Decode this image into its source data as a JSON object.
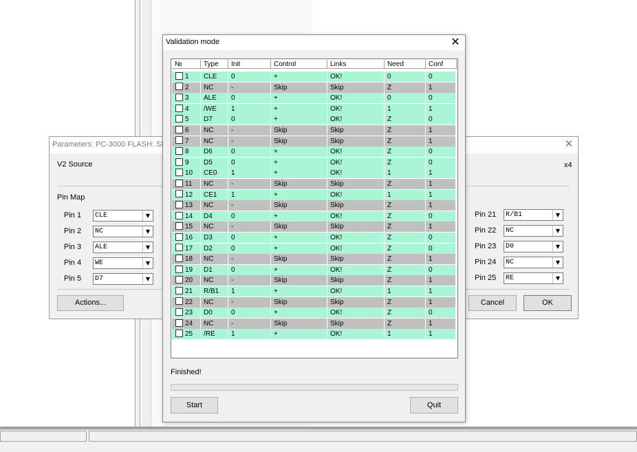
{
  "params_dialog": {
    "title": "Parameters: PC-3000 FLASH: SPID",
    "v2_source_label": "V2 Source",
    "x4_label": "x4",
    "pin_map_label": "Pin Map",
    "left_pins": [
      {
        "label": "Pin 1",
        "value": "CLE"
      },
      {
        "label": "Pin 2",
        "value": "NC"
      },
      {
        "label": "Pin 3",
        "value": "ALE"
      },
      {
        "label": "Pin 4",
        "value": "WE"
      },
      {
        "label": "Pin 5",
        "value": "D7"
      }
    ],
    "right_pins": [
      {
        "label": "Pin 21",
        "value": "R/B1"
      },
      {
        "label": "Pin 22",
        "value": "NC"
      },
      {
        "label": "Pin 23",
        "value": "D0"
      },
      {
        "label": "Pin 24",
        "value": "NC"
      },
      {
        "label": "Pin 25",
        "value": "RE"
      }
    ],
    "actions_label": "Actions...",
    "cancel_label": "Cancel",
    "ok_label": "OK"
  },
  "validation_dialog": {
    "title": "Validation mode",
    "close_glyph": "✕",
    "columns": [
      "№",
      "Type",
      "Init",
      "Control",
      "Links",
      "Need",
      "Conf"
    ],
    "rows": [
      {
        "n": "1",
        "type": "CLE",
        "init": "0",
        "control": "+",
        "links": "OK!",
        "need": "0",
        "conf": "0",
        "status": "ok"
      },
      {
        "n": "2",
        "type": "NC",
        "init": "-",
        "control": "Skip",
        "links": "Skip",
        "need": "Z",
        "conf": "1",
        "status": "skip"
      },
      {
        "n": "3",
        "type": "ALE",
        "init": "0",
        "control": "+",
        "links": "OK!",
        "need": "0",
        "conf": "0",
        "status": "ok"
      },
      {
        "n": "4",
        "type": "/WE",
        "init": "1",
        "control": "+",
        "links": "OK!",
        "need": "1",
        "conf": "1",
        "status": "ok"
      },
      {
        "n": "5",
        "type": "D7",
        "init": "0",
        "control": "+",
        "links": "OK!",
        "need": "Z",
        "conf": "0",
        "status": "ok"
      },
      {
        "n": "6",
        "type": "NC",
        "init": "-",
        "control": "Skip",
        "links": "Skip",
        "need": "Z",
        "conf": "1",
        "status": "skip"
      },
      {
        "n": "7",
        "type": "NC",
        "init": "-",
        "control": "Skip",
        "links": "Skip",
        "need": "Z",
        "conf": "1",
        "status": "skip"
      },
      {
        "n": "8",
        "type": "D6",
        "init": "0",
        "control": "+",
        "links": "OK!",
        "need": "Z",
        "conf": "0",
        "status": "ok"
      },
      {
        "n": "9",
        "type": "D5",
        "init": "0",
        "control": "+",
        "links": "OK!",
        "need": "Z",
        "conf": "0",
        "status": "ok"
      },
      {
        "n": "10",
        "type": "CE0",
        "init": "1",
        "control": "+",
        "links": "OK!",
        "need": "1",
        "conf": "1",
        "status": "ok"
      },
      {
        "n": "11",
        "type": "NC",
        "init": "-",
        "control": "Skip",
        "links": "Skip",
        "need": "Z",
        "conf": "1",
        "status": "skip"
      },
      {
        "n": "12",
        "type": "CE1",
        "init": "1",
        "control": "+",
        "links": "OK!",
        "need": "1",
        "conf": "1",
        "status": "ok"
      },
      {
        "n": "13",
        "type": "NC",
        "init": "-",
        "control": "Skip",
        "links": "Skip",
        "need": "Z",
        "conf": "1",
        "status": "skip"
      },
      {
        "n": "14",
        "type": "D4",
        "init": "0",
        "control": "+",
        "links": "OK!",
        "need": "Z",
        "conf": "0",
        "status": "ok"
      },
      {
        "n": "15",
        "type": "NC",
        "init": "-",
        "control": "Skip",
        "links": "Skip",
        "need": "Z",
        "conf": "1",
        "status": "skip"
      },
      {
        "n": "16",
        "type": "D3",
        "init": "0",
        "control": "+",
        "links": "OK!",
        "need": "Z",
        "conf": "0",
        "status": "ok"
      },
      {
        "n": "17",
        "type": "D2",
        "init": "0",
        "control": "+",
        "links": "OK!",
        "need": "Z",
        "conf": "0",
        "status": "ok"
      },
      {
        "n": "18",
        "type": "NC",
        "init": "-",
        "control": "Skip",
        "links": "Skip",
        "need": "Z",
        "conf": "1",
        "status": "skip"
      },
      {
        "n": "19",
        "type": "D1",
        "init": "0",
        "control": "+",
        "links": "OK!",
        "need": "Z",
        "conf": "0",
        "status": "ok"
      },
      {
        "n": "20",
        "type": "NC",
        "init": "-",
        "control": "Skip",
        "links": "Skip",
        "need": "Z",
        "conf": "1",
        "status": "skip"
      },
      {
        "n": "21",
        "type": "R/B1",
        "init": "1",
        "control": "+",
        "links": "OK!",
        "need": "1",
        "conf": "1",
        "status": "ok"
      },
      {
        "n": "22",
        "type": "NC",
        "init": "-",
        "control": "Skip",
        "links": "Skip",
        "need": "Z",
        "conf": "1",
        "status": "skip"
      },
      {
        "n": "23",
        "type": "D0",
        "init": "0",
        "control": "+",
        "links": "OK!",
        "need": "Z",
        "conf": "0",
        "status": "ok"
      },
      {
        "n": "24",
        "type": "NC",
        "init": "-",
        "control": "Skip",
        "links": "Skip",
        "need": "Z",
        "conf": "1",
        "status": "skip"
      },
      {
        "n": "25",
        "type": "/RE",
        "init": "1",
        "control": "+",
        "links": "OK!",
        "need": "1",
        "conf": "1",
        "status": "ok"
      }
    ],
    "status_text": "Finished!",
    "start_label": "Start",
    "quit_label": "Quit"
  },
  "colors": {
    "ok_row": "#aaf5d6",
    "skip_row": "#c0c0c0"
  }
}
